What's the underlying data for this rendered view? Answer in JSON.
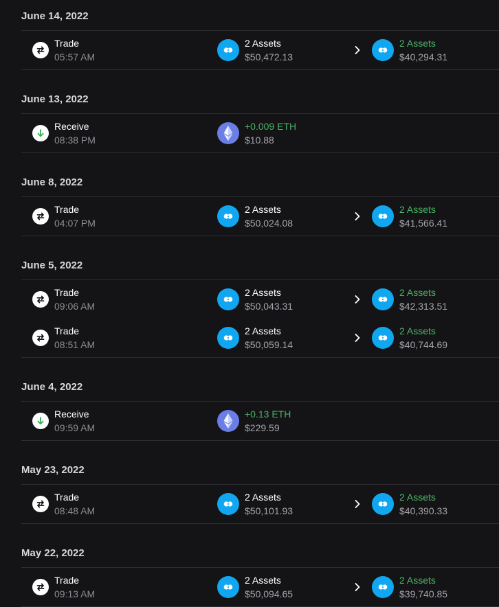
{
  "groups": [
    {
      "date": "June 14, 2022",
      "transactions": [
        {
          "kind": "trade",
          "label": "Trade",
          "time": "05:57 AM",
          "from_label": "2 Assets",
          "from_value": "$50,472.13",
          "to_label": "2 Assets",
          "to_value": "$40,294.31"
        }
      ]
    },
    {
      "date": "June 13, 2022",
      "transactions": [
        {
          "kind": "receive",
          "label": "Receive",
          "time": "08:38 PM",
          "amount": "+0.009 ETH",
          "value": "$10.88"
        }
      ]
    },
    {
      "date": "June 8, 2022",
      "transactions": [
        {
          "kind": "trade",
          "label": "Trade",
          "time": "04:07 PM",
          "from_label": "2 Assets",
          "from_value": "$50,024.08",
          "to_label": "2 Assets",
          "to_value": "$41,566.41"
        }
      ]
    },
    {
      "date": "June 5, 2022",
      "transactions": [
        {
          "kind": "trade",
          "label": "Trade",
          "time": "09:06 AM",
          "from_label": "2 Assets",
          "from_value": "$50,043.31",
          "to_label": "2 Assets",
          "to_value": "$42,313.51"
        },
        {
          "kind": "trade",
          "label": "Trade",
          "time": "08:51 AM",
          "from_label": "2 Assets",
          "from_value": "$50,059.14",
          "to_label": "2 Assets",
          "to_value": "$40,744.69"
        }
      ]
    },
    {
      "date": "June 4, 2022",
      "transactions": [
        {
          "kind": "receive",
          "label": "Receive",
          "time": "09:59 AM",
          "amount": "+0.13 ETH",
          "value": "$229.59"
        }
      ]
    },
    {
      "date": "May 23, 2022",
      "transactions": [
        {
          "kind": "trade",
          "label": "Trade",
          "time": "08:48 AM",
          "from_label": "2 Assets",
          "from_value": "$50,101.93",
          "to_label": "2 Assets",
          "to_value": "$40,390.33"
        }
      ]
    },
    {
      "date": "May 22, 2022",
      "transactions": [
        {
          "kind": "trade",
          "label": "Trade",
          "time": "09:13 AM",
          "from_label": "2 Assets",
          "from_value": "$50,094.65",
          "to_label": "2 Assets",
          "to_value": "$39,740.85"
        }
      ]
    }
  ],
  "icons": {
    "trade": "swap-arrows-icon",
    "receive": "receive-arrow-icon",
    "assets": "multi-asset-icon",
    "eth": "ethereum-icon",
    "chevron": "chevron-right-icon"
  },
  "colors": {
    "background": "#141417",
    "divider": "#2c2c31",
    "asset_blue": "#11a7f0",
    "eth_purple": "#6a7ee6",
    "positive_green": "#49b463",
    "muted_text": "#8d8d93"
  }
}
